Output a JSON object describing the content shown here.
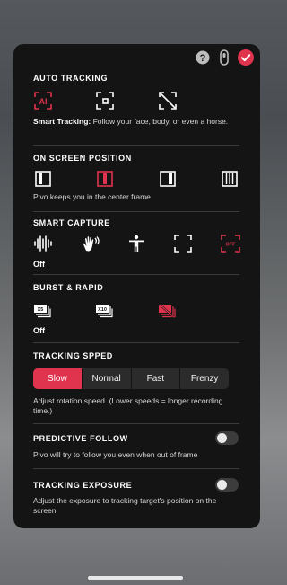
{
  "accent_color": "#e0334d",
  "auto_tracking": {
    "title": "AUTO TRACKING",
    "icons": [
      "ai-tracking-icon",
      "smart-target-icon",
      "tracking-off-icon"
    ],
    "desc_bold": "Smart Tracking:",
    "desc_rest": " Follow your face, body, or even a horse."
  },
  "screen_position": {
    "title": "ON SCREEN POSITION",
    "icons": [
      "position-left-icon",
      "position-center-icon",
      "position-right-icon",
      "position-full-icon"
    ],
    "desc": "Pivo keeps you in the center frame"
  },
  "smart_capture": {
    "title": "SMART CAPTURE",
    "icons": [
      "sound-wave-icon",
      "hand-wave-icon",
      "body-pose-icon",
      "frame-icon",
      "capture-off-icon"
    ],
    "off_badge": "OFF",
    "status": "Off"
  },
  "burst_rapid": {
    "title": "BURST & RAPID",
    "icons": [
      "burst-x5-icon",
      "burst-x10-icon",
      "burst-off-icon"
    ],
    "x5": "X5",
    "x10": "X10",
    "status": "Off"
  },
  "tracking_speed": {
    "title": "TRACKING SPPED",
    "options": [
      "Slow",
      "Normal",
      "Fast",
      "Frenzy"
    ],
    "selected": "Slow",
    "desc": "Adjust rotation speed. (Lower speeds = longer recording time.)"
  },
  "predictive_follow": {
    "title": "PREDICTIVE FOLLOW",
    "desc": "Pivo will try to follow you even when out of frame",
    "enabled": false
  },
  "tracking_exposure": {
    "title": "TRACKING EXPOSURE",
    "desc": "Adjust the exposure to tracking target's position on the screen",
    "enabled": false
  }
}
